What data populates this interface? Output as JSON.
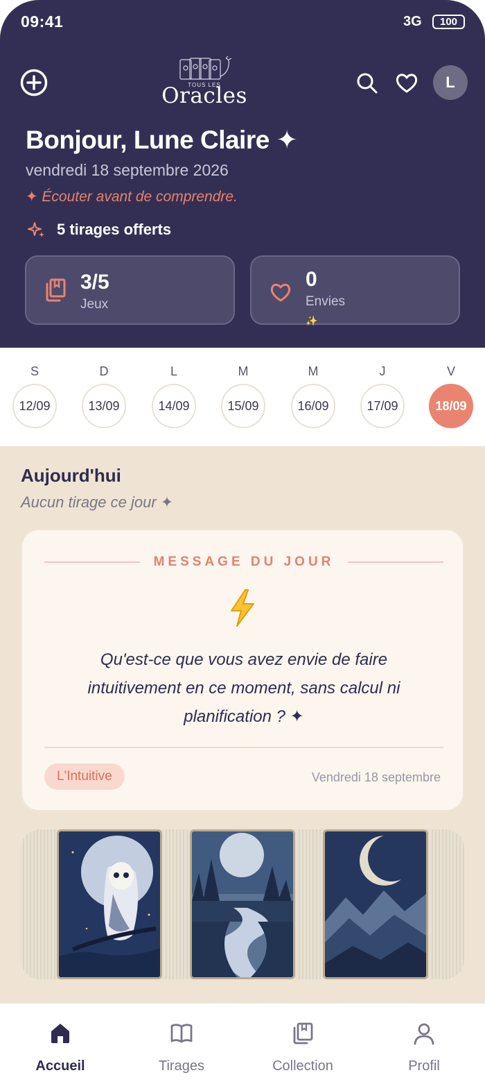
{
  "status_bar": {
    "time": "09:41",
    "network": "3G",
    "battery": "100"
  },
  "header": {
    "logo_small": "TOUS LES",
    "logo_main": "Oracles",
    "avatar_initial": "L",
    "greeting": "Bonjour, Lune Claire ✦",
    "date": "vendredi 18 septembre 2026",
    "quote": "✦ Écouter avant de comprendre.",
    "offers_label": "5 tirages offerts"
  },
  "stats": [
    {
      "value": "3/5",
      "label": "Jeux",
      "icon": "collection-icon"
    },
    {
      "value": "0",
      "label": "Envies",
      "icon": "heart-icon",
      "sparkle": "✨"
    }
  ],
  "days": [
    {
      "letter": "S",
      "date": "12/09",
      "active": false
    },
    {
      "letter": "D",
      "date": "13/09",
      "active": false
    },
    {
      "letter": "L",
      "date": "14/09",
      "active": false
    },
    {
      "letter": "M",
      "date": "15/09",
      "active": false
    },
    {
      "letter": "M",
      "date": "16/09",
      "active": false
    },
    {
      "letter": "J",
      "date": "17/09",
      "active": false
    },
    {
      "letter": "V",
      "date": "18/09",
      "active": true
    }
  ],
  "today": {
    "title": "Aujourd'hui",
    "subtitle": "Aucun tirage ce jour ✦"
  },
  "message": {
    "heading": "MESSAGE DU JOUR",
    "icon": "lightning-icon",
    "text": "Qu'est-ce que vous avez envie de faire intuitivement en ce moment, sans calcul ni planification ? ✦",
    "badge": "L'Intuitive",
    "date": "Vendredi 18 septembre"
  },
  "nav": [
    {
      "label": "Accueil",
      "icon": "home-icon",
      "active": true
    },
    {
      "label": "Tirages",
      "icon": "book-icon",
      "active": false
    },
    {
      "label": "Collection",
      "icon": "collection-icon",
      "active": false
    },
    {
      "label": "Profil",
      "icon": "user-icon",
      "active": false
    }
  ],
  "colors": {
    "header_bg": "#332f54",
    "accent": "#ea8470",
    "page_bg": "#efe4d3"
  }
}
